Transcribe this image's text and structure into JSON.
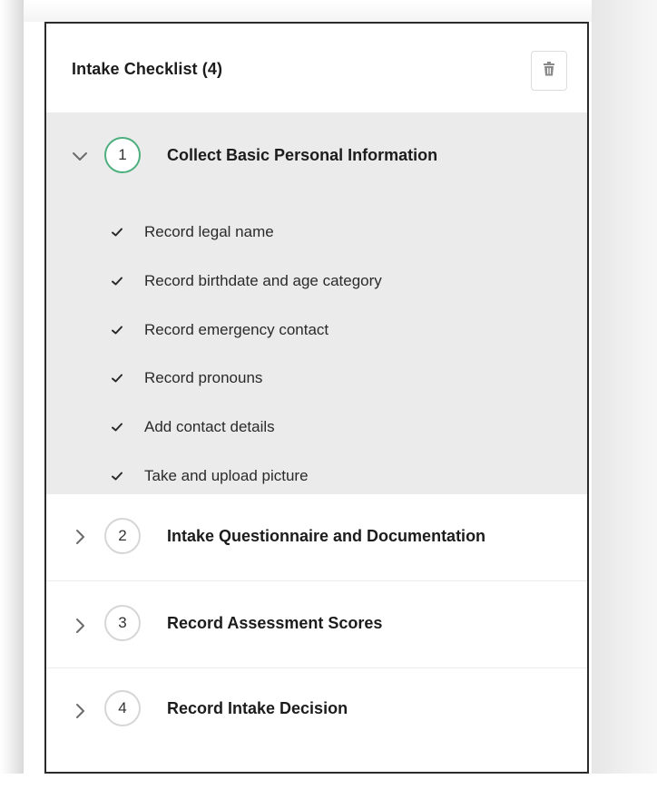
{
  "panel": {
    "title": "Intake Checklist (4)",
    "delete_icon": "trash-icon"
  },
  "steps": [
    {
      "number": "1",
      "title": "Collect Basic Personal Information",
      "expanded": true,
      "tasks": [
        "Record legal name",
        "Record birthdate and age category",
        "Record emergency contact",
        "Record pronouns",
        "Add contact details",
        "Take and upload picture"
      ]
    },
    {
      "number": "2",
      "title": "Intake Questionnaire and Documentation",
      "expanded": false
    },
    {
      "number": "3",
      "title": "Record Assessment Scores",
      "expanded": false
    },
    {
      "number": "4",
      "title": "Record Intake Decision",
      "expanded": false
    }
  ],
  "colors": {
    "active_step_ring": "#4caf7d",
    "inactive_step_ring": "#d6d6d6",
    "expanded_background": "#ebebeb"
  }
}
